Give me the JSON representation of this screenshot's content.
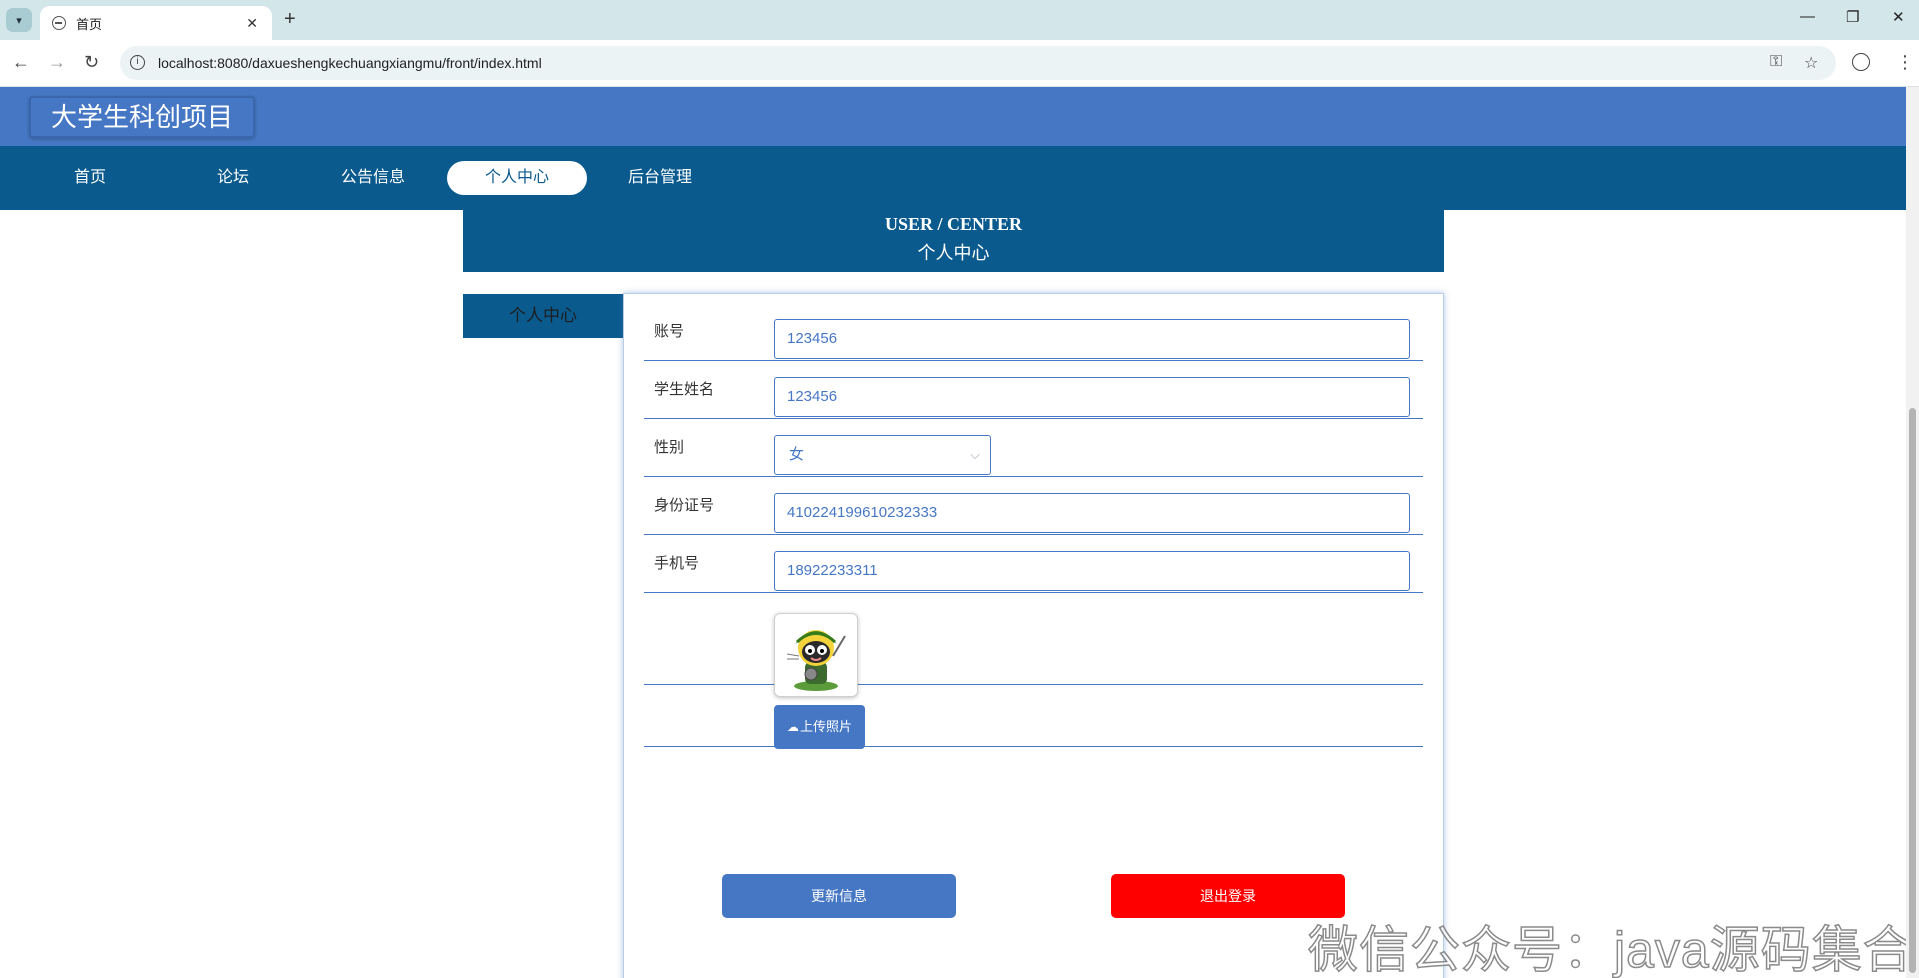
{
  "browser": {
    "tab_title": "首页",
    "url": "localhost:8080/daxueshengkechuangxiangmu/front/index.html"
  },
  "site": {
    "title": "大学生科创项目"
  },
  "nav": {
    "items": [
      {
        "label": "首页",
        "active": false
      },
      {
        "label": "论坛",
        "active": false
      },
      {
        "label": "公告信息",
        "active": false
      },
      {
        "label": "个人中心",
        "active": true
      },
      {
        "label": "后台管理",
        "active": false
      }
    ]
  },
  "banner": {
    "en": "USER / CENTER",
    "cn": "个人中心"
  },
  "side_menu": {
    "item": "个人中心"
  },
  "form": {
    "account": {
      "label": "账号",
      "value": "123456"
    },
    "student_name": {
      "label": "学生姓名",
      "value": "123456"
    },
    "gender": {
      "label": "性别",
      "value": "女"
    },
    "id_number": {
      "label": "身份证号",
      "value": "410224199610232333"
    },
    "phone": {
      "label": "手机号",
      "value": "18922233311"
    },
    "upload_label": "上传照片",
    "update_label": "更新信息",
    "logout_label": "退出登录"
  },
  "colors": {
    "header_blue": "#4677c4",
    "nav_dark_blue": "#0a5a8e",
    "logout_red": "#ff0000"
  },
  "watermark": "微信公众号：java源码集合"
}
